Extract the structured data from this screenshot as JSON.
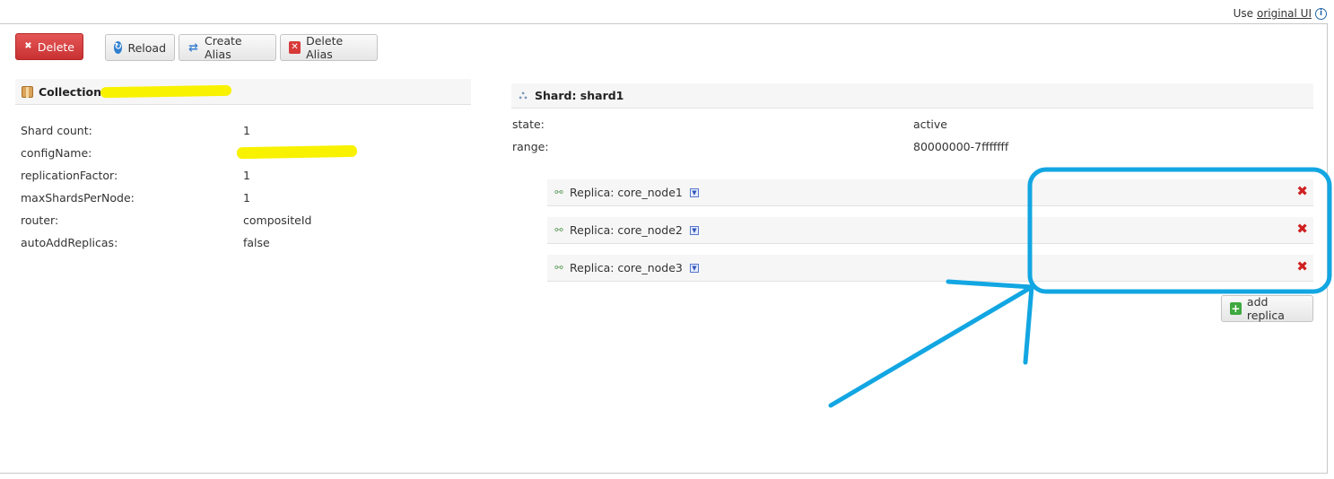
{
  "top": {
    "use_text": "Use",
    "original_ui_link": "original UI",
    "info_icon": "i"
  },
  "toolbar": {
    "delete_label": "Delete",
    "reload_label": "Reload",
    "create_alias_label": "Create Alias",
    "delete_alias_label": "Delete Alias"
  },
  "collection": {
    "title": "Collection:",
    "properties": [
      {
        "label": "Shard count:",
        "value": "1"
      },
      {
        "label": "configName:",
        "value": ""
      },
      {
        "label": "replicationFactor:",
        "value": "1"
      },
      {
        "label": "maxShardsPerNode:",
        "value": "1"
      },
      {
        "label": "router:",
        "value": "compositeId"
      },
      {
        "label": "autoAddReplicas:",
        "value": "false"
      }
    ]
  },
  "shard": {
    "title": "Shard: shard1",
    "properties": [
      {
        "label": "state:",
        "value": "active"
      },
      {
        "label": "range:",
        "value": "80000000-7fffffff"
      }
    ],
    "replicas": [
      {
        "label": "Replica: core_node1"
      },
      {
        "label": "Replica: core_node2"
      },
      {
        "label": "Replica: core_node3"
      }
    ],
    "add_replica_label": "add replica"
  },
  "colors": {
    "delete_button": "#d43f3f",
    "remove_icon": "#d02020",
    "annotation_stroke": "#12a6e2",
    "redaction_highlight": "#f8f200"
  }
}
